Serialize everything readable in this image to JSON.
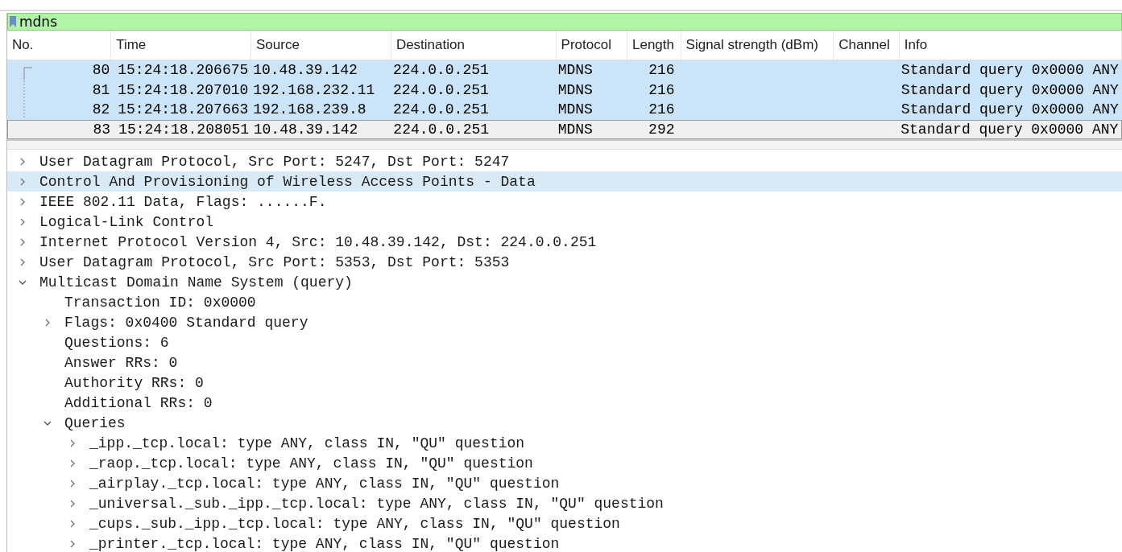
{
  "filter": {
    "value": "mdns"
  },
  "columns": [
    "No.",
    "Time",
    "Source",
    "Destination",
    "Protocol",
    "Length",
    "Signal strength (dBm)",
    "Channel",
    "Info"
  ],
  "packets": [
    {
      "no": "80",
      "time": "15:24:18.206675",
      "source": "10.48.39.142",
      "destination": "224.0.0.251",
      "protocol": "MDNS",
      "length": "216",
      "info": "Standard query 0x0000 ANY",
      "related": true,
      "selected": false
    },
    {
      "no": "81",
      "time": "15:24:18.207010",
      "source": "192.168.232.11",
      "destination": "224.0.0.251",
      "protocol": "MDNS",
      "length": "216",
      "info": "Standard query 0x0000 ANY",
      "related": true,
      "selected": false
    },
    {
      "no": "82",
      "time": "15:24:18.207663",
      "source": "192.168.239.8",
      "destination": "224.0.0.251",
      "protocol": "MDNS",
      "length": "216",
      "info": "Standard query 0x0000 ANY",
      "related": true,
      "selected": false
    },
    {
      "no": "83",
      "time": "15:24:18.208051",
      "source": "10.48.39.142",
      "destination": "224.0.0.251",
      "protocol": "MDNS",
      "length": "292",
      "info": "Standard query 0x0000 ANY",
      "related": false,
      "selected": true
    }
  ],
  "details": [
    {
      "kind": "branch",
      "text": "User Datagram Protocol, Src Port: 5247, Dst Port: 5247",
      "expanded": false,
      "selected": false
    },
    {
      "kind": "branch",
      "text": "Control And Provisioning of Wireless Access Points - Data",
      "expanded": false,
      "selected": true
    },
    {
      "kind": "branch",
      "text": "IEEE 802.11 Data, Flags: ......F.",
      "expanded": false,
      "selected": false
    },
    {
      "kind": "branch",
      "text": "Logical-Link Control",
      "expanded": false,
      "selected": false
    },
    {
      "kind": "branch",
      "text": "Internet Protocol Version 4, Src: 10.48.39.142, Dst: 224.0.0.251",
      "expanded": false,
      "selected": false
    },
    {
      "kind": "branch",
      "text": "User Datagram Protocol, Src Port: 5353, Dst Port: 5353",
      "expanded": false,
      "selected": false
    },
    {
      "kind": "branch",
      "text": "Multicast Domain Name System (query)",
      "expanded": true,
      "selected": false,
      "children": [
        {
          "kind": "leaf",
          "text": "Transaction ID: 0x0000",
          "selected": false
        },
        {
          "kind": "branch",
          "text": "Flags: 0x0400 Standard query",
          "expanded": false,
          "selected": false
        },
        {
          "kind": "leaf",
          "text": "Questions: 6",
          "selected": false
        },
        {
          "kind": "leaf",
          "text": "Answer RRs: 0",
          "selected": false
        },
        {
          "kind": "leaf",
          "text": "Authority RRs: 0",
          "selected": false
        },
        {
          "kind": "leaf",
          "text": "Additional RRs: 0",
          "selected": false
        },
        {
          "kind": "branch",
          "text": "Queries",
          "expanded": true,
          "selected": false,
          "children": [
            {
              "kind": "branch",
              "text": "_ipp._tcp.local: type ANY, class IN, \"QU\" question",
              "expanded": false,
              "selected": false
            },
            {
              "kind": "branch",
              "text": "_raop._tcp.local: type ANY, class IN, \"QU\" question",
              "expanded": false,
              "selected": false
            },
            {
              "kind": "branch",
              "text": "_airplay._tcp.local: type ANY, class IN, \"QU\" question",
              "expanded": false,
              "selected": false
            },
            {
              "kind": "branch",
              "text": "_universal._sub._ipp._tcp.local: type ANY, class IN, \"QU\" question",
              "expanded": false,
              "selected": false
            },
            {
              "kind": "branch",
              "text": "_cups._sub._ipp._tcp.local: type ANY, class IN, \"QU\" question",
              "expanded": false,
              "selected": false
            },
            {
              "kind": "branch",
              "text": "_printer._tcp.local: type ANY, class IN, \"QU\" question",
              "expanded": false,
              "selected": false
            }
          ]
        }
      ]
    }
  ]
}
